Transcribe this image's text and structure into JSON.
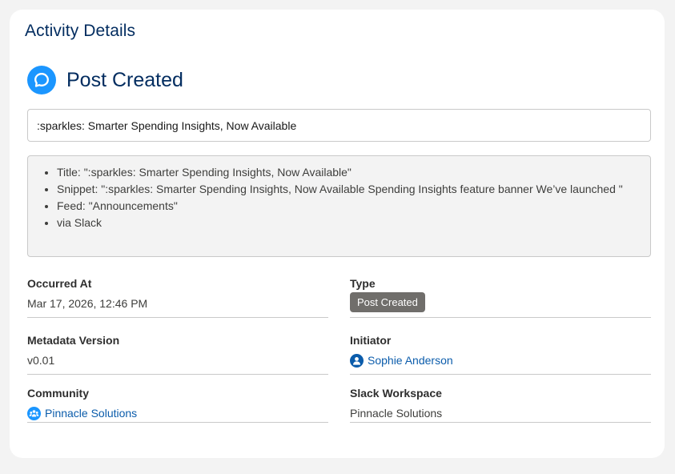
{
  "card": {
    "title": "Activity Details"
  },
  "event": {
    "icon": "chat-bubble-icon",
    "title": "Post Created",
    "summary": ":sparkles: Smarter Spending Insights, Now Available"
  },
  "details": [
    "Title: \":sparkles: Smarter Spending Insights, Now Available\"",
    "Snippet: \":sparkles: Smarter Spending Insights, Now Available Spending Insights feature banner We’ve launched \"",
    "Feed: \"Announcements\"",
    "via Slack"
  ],
  "fields": {
    "occurred_at": {
      "label": "Occurred At",
      "value": "Mar 17, 2026, 12:46 PM"
    },
    "type": {
      "label": "Type",
      "value": "Post Created"
    },
    "metadata_version": {
      "label": "Metadata Version",
      "value": "v0.01"
    },
    "initiator": {
      "label": "Initiator",
      "value": "Sophie Anderson",
      "icon": "user-icon"
    },
    "community": {
      "label": "Community",
      "value": "Pinnacle Solutions",
      "icon": "community-icon"
    },
    "slack_workspace": {
      "label": "Slack Workspace",
      "value": "Pinnacle Solutions"
    }
  },
  "colors": {
    "accent": "#1b96ff",
    "title": "#032d60",
    "link": "#0b5cab",
    "badge": "#706e6b"
  }
}
